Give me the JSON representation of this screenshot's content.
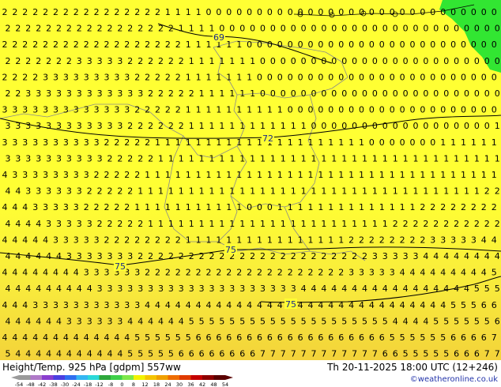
{
  "title": "Height/Temp. 925 hPa [gdpm] 557ww",
  "valid_time": "Th 20-11-2025 18:00 UTC (12+246)",
  "credit": "©weatheronline.co.uk",
  "contour_labels": [
    "69",
    "72",
    "75",
    "75",
    "75"
  ],
  "colorbar": {
    "ticks": [
      "-54",
      "-48",
      "-42",
      "-38",
      "-30",
      "-24",
      "-18",
      "-12",
      "-8",
      "0",
      "8",
      "12",
      "18",
      "24",
      "30",
      "36",
      "42",
      "48",
      "54"
    ],
    "colors": [
      "#9b9b9b",
      "#b07ac8",
      "#8a3ecf",
      "#4b3fe0",
      "#2f6ff0",
      "#35b6f2",
      "#2bd9d9",
      "#2ea83c",
      "#3fd04a",
      "#7ee84a",
      "#f2f200",
      "#f5c400",
      "#f0a000",
      "#ee6c00",
      "#e03a00",
      "#c40000",
      "#8e0000",
      "#5a0000"
    ]
  },
  "colors": {
    "zero_band": "#ffff33",
    "warm_band": "#f7e63c",
    "warmer_band": "#f3d33a",
    "cold_patch": "#32e632"
  },
  "grid_rows": [
    "2222222222222222111100000000000000000000000000000",
    "2222222222222222211110000000000000000000000000000",
    "2222222222222222221111110000000000000000000000000",
    "2222222333332222221111111000000000000000000000000",
    "2222333333333222221111111000000000000000000000000",
    "2233333333333322222111111000000000000000000000000",
    "3333333333333222221111111111000000000000000000000",
    "3333333333332222221111111111110000000000000000001",
    "3333333333222221111111111111111111110000000111111",
    "3333333333222221111111111111111111111111111111111",
    "4333333332222211111111111111111111111111111111111",
    "4433333322222111111111111111111111111111111111122",
    "4443333322222111111111110001111111111111122222222",
    "4444333332222211111111111111111111111122222222222",
    "4444433333222222221111111111111111222222223333344",
    "4444443333333222222222222222222222223333344444444",
    "4444444433333322222222222222222222333334444444445",
    "4444444443333333333333333333344444444444444444555",
    "4443333333333344444444444444444444444444444455566",
    "4444443333334444445555555555555555555544445555556",
    "4444444444444555555666666666666666666655555566667",
    "5444444444445555566666666777777777777665555566677"
  ]
}
